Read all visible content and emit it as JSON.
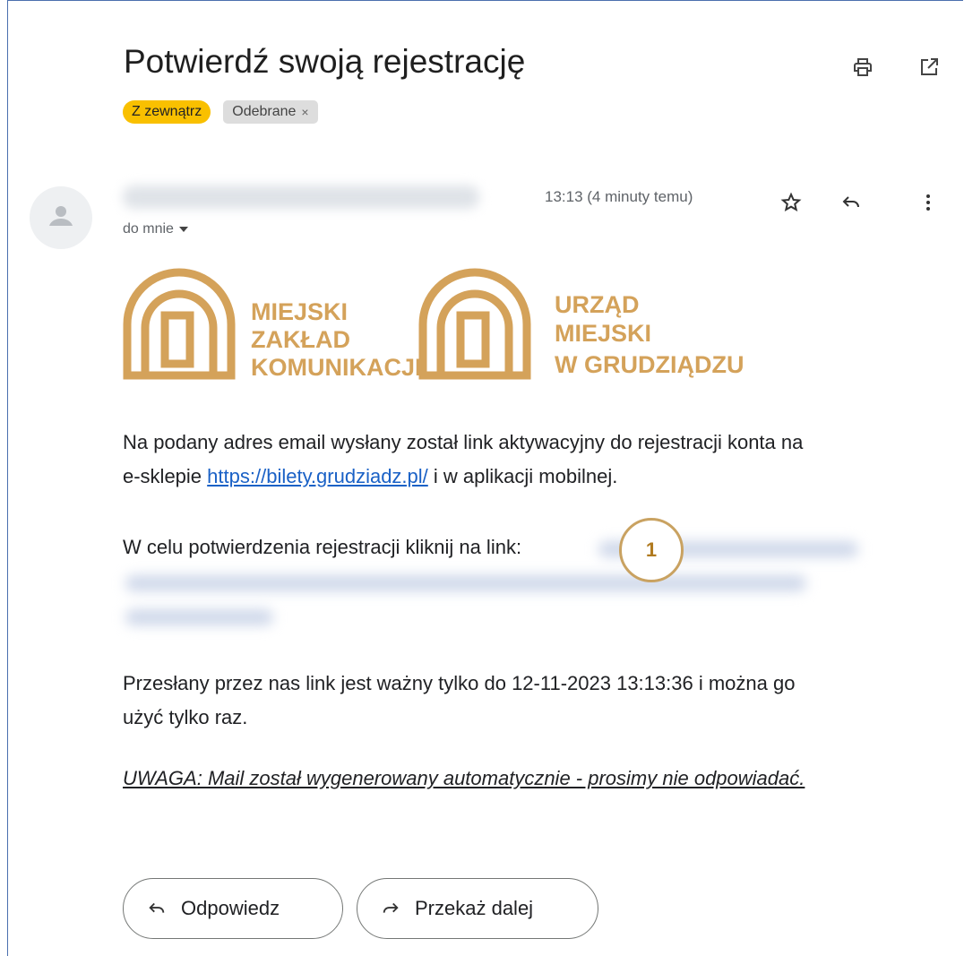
{
  "email": {
    "subject": "Potwierdź swoją rejestrację",
    "labels": {
      "external": "Z zewnątrz",
      "inbox": "Odebrane",
      "inbox_remove": "×"
    },
    "to_me": "do mnie",
    "time": "13:13 (4 minuty temu)",
    "icons": [
      "print-icon",
      "open-in-new-window-icon",
      "star-icon",
      "reply-icon",
      "more-vert-icon",
      "avatar-person-icon",
      "dropdown-caret-icon",
      "forward-icon"
    ]
  },
  "logo": {
    "left_text": [
      "MIEJSKI",
      "ZAKŁAD",
      "KOMUNIKACJI"
    ],
    "right_text": [
      "URZĄD",
      "MIEJSKI",
      "W GRUDZIĄDZU"
    ],
    "color": "#d4a25a"
  },
  "body": {
    "p1_line1": "Na podany adres email wysłany został link aktywacyjny do rejestracji konta na",
    "p1_prefix": "e-sklepie",
    "p1_link": "https://bilety.grudziadz.pl/",
    "p1_suffix": "i w aplikacji mobilnej.",
    "p2": "W celu potwierdzenia rejestracji kliknij na link:",
    "p3_line1": "Przesłany przez nas link jest ważny tylko do 12-11-2023 13:13:36 i można go",
    "p3_line2": "użyć tylko raz.",
    "warning": "UWAGA: Mail został wygenerowany automatycznie - prosimy nie odpowiadać."
  },
  "annotation": {
    "number": "1",
    "color": "#c9a261"
  },
  "buttons": {
    "reply": "Odpowiedz",
    "forward": "Przekaż dalej"
  }
}
